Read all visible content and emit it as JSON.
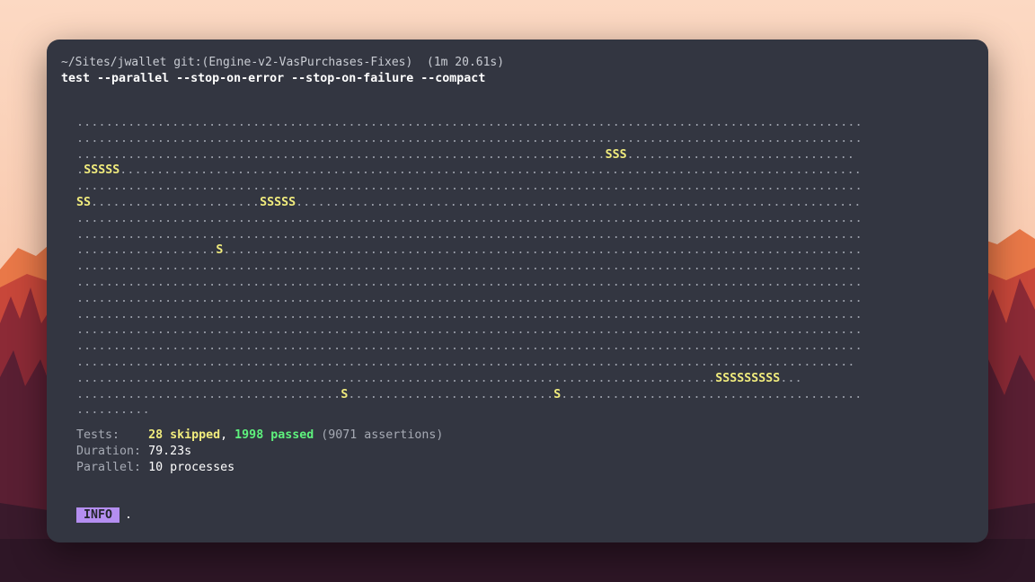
{
  "header": {
    "path": "~/Sites/jwallet git:(Engine-v2-VasPurchases-Fixes)  (1m 20.61s)",
    "command": "test --parallel --stop-on-error --stop-on-failure --compact"
  },
  "progress_rows": [
    "...........................................................................................................",
    "...........................................................................................................",
    "........................................................................SSS...............................",
    ".SSSSS.....................................................................................................",
    "...........................................................................................................",
    "SS.......................SSSSS.............................................................................",
    "...........................................................................................................",
    "...........................................................................................................",
    "...................S.......................................................................................",
    "...........................................................................................................",
    "...........................................................................................................",
    "...........................................................................................................",
    "...........................................................................................................",
    "...........................................................................................................",
    "...........................................................................................................",
    "..........................................................................................................",
    ".......................................................................................SSSSSSSSS...",
    "....................................S............................S.........................................",
    ".........."
  ],
  "summary": {
    "tests_label": "Tests:",
    "skipped": "28 skipped",
    "separator": ",",
    "passed": "1998 passed",
    "assertions": "(9071 assertions)",
    "duration_label": "Duration:",
    "duration_value": "79.23s",
    "parallel_label": "Parallel:",
    "parallel_value": "10 processes"
  },
  "info": {
    "badge": "INFO",
    "text": "."
  },
  "colors": {
    "terminal_bg": "#333641",
    "skip": "#f1ec7d",
    "pass": "#5ef27d",
    "badge": "#b48ef0",
    "sky": "#fcd9c3"
  }
}
